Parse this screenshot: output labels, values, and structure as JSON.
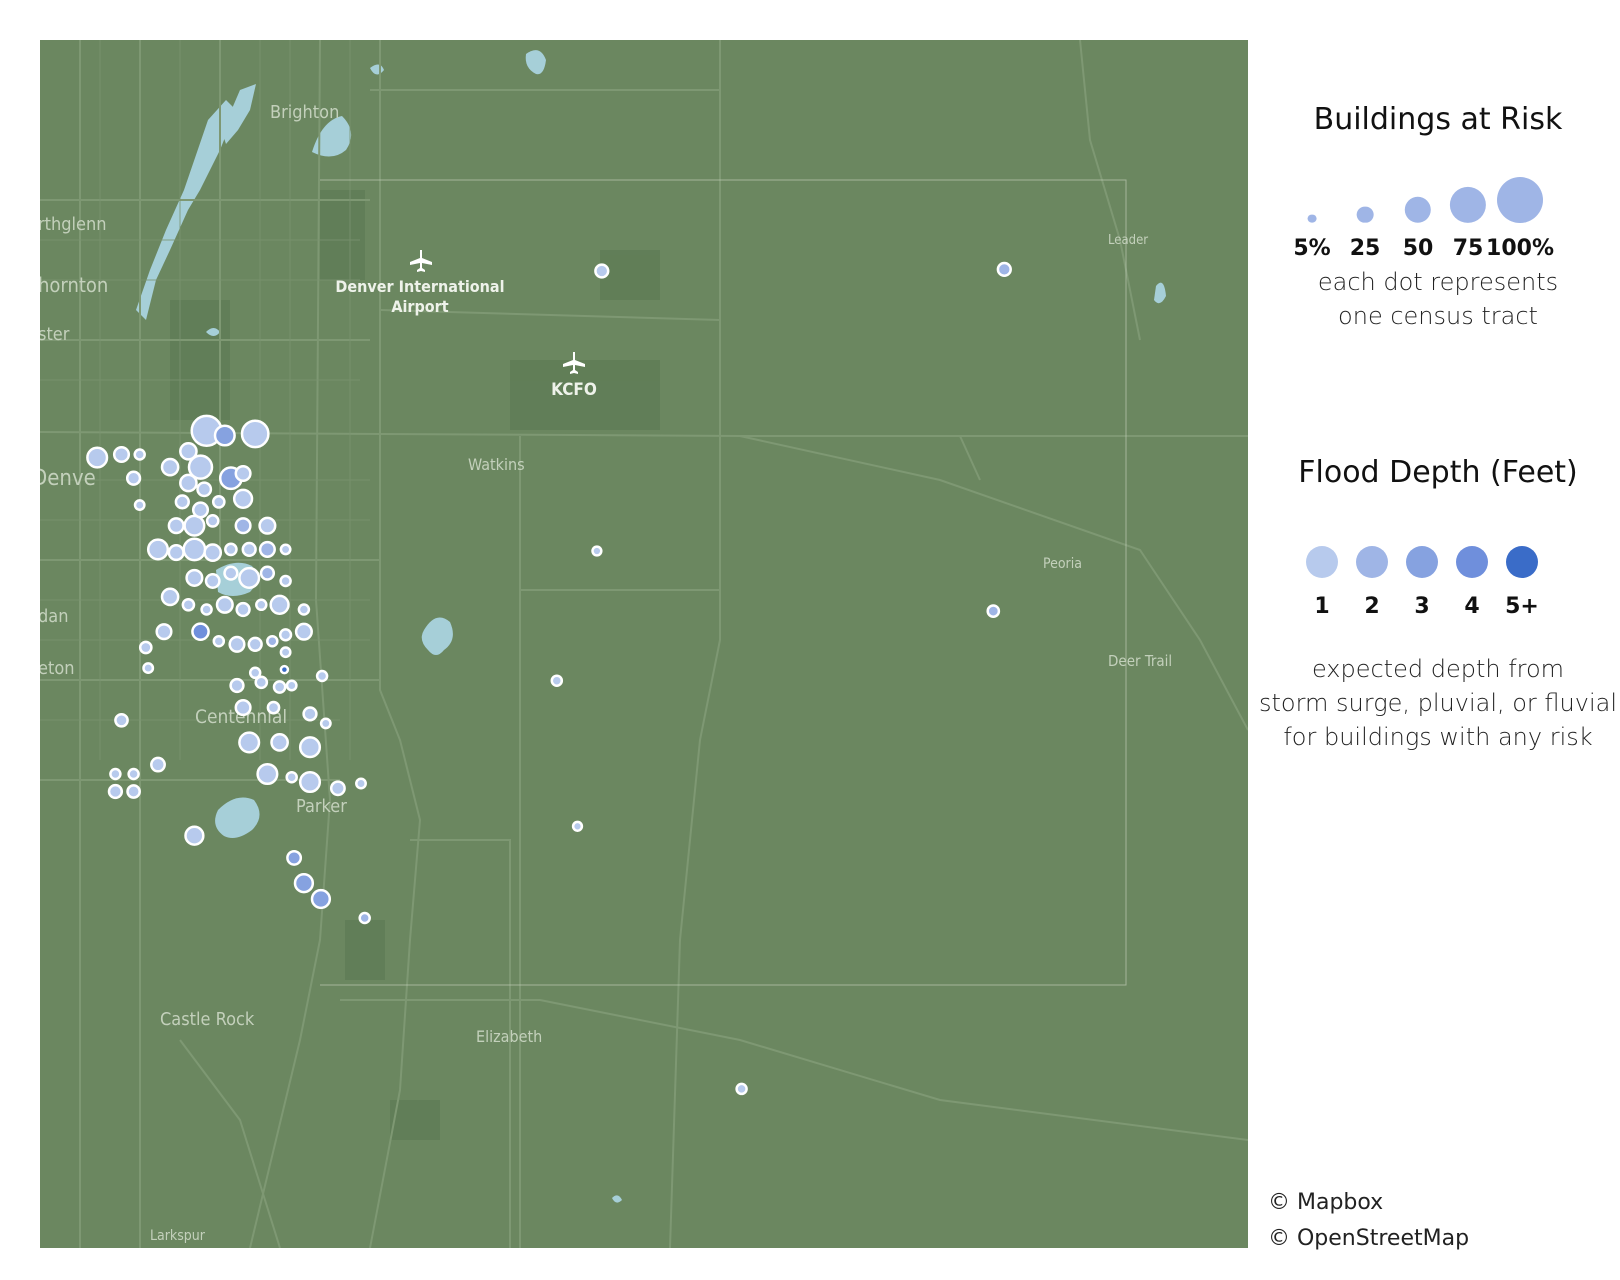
{
  "map": {
    "place_labels": [
      {
        "id": "brighton",
        "text": "Brighton"
      },
      {
        "id": "northglenn",
        "text": "rthglenn"
      },
      {
        "id": "thornton",
        "text": "hornton"
      },
      {
        "id": "westminster",
        "text": "ster"
      },
      {
        "id": "denver",
        "text": "Denve"
      },
      {
        "id": "sheridan",
        "text": "dan"
      },
      {
        "id": "littleton",
        "text": "eton"
      },
      {
        "id": "centennial",
        "text": "Centennial"
      },
      {
        "id": "parker",
        "text": "Parker"
      },
      {
        "id": "castle-rock",
        "text": "Castle Rock"
      },
      {
        "id": "elizabeth",
        "text": "Elizabeth"
      },
      {
        "id": "larkspur",
        "text": "Larkspur"
      },
      {
        "id": "watkins",
        "text": "Watkins"
      },
      {
        "id": "leader",
        "text": "Leader"
      },
      {
        "id": "peoria",
        "text": "Peoria"
      },
      {
        "id": "deer-trail",
        "text": "Deer Trail"
      },
      {
        "id": "dia-line1",
        "text": "Denver International"
      },
      {
        "id": "dia-line2",
        "text": "Airport"
      },
      {
        "id": "kcfo",
        "text": "KCFO"
      }
    ],
    "colors": {
      "land": "#6b8760",
      "road": "#7e9873",
      "water": "#a6cfd8",
      "park": "#5f7c56",
      "dot_outline": "#ffffff",
      "depth": [
        "#b7caed",
        "#9fb5e6",
        "#86a2e0",
        "#6f8fdc",
        "#3a6cc8"
      ]
    },
    "tracts": [
      {
        "lon": -104.95,
        "lat": 39.748,
        "risk": 40,
        "depth": 1
      },
      {
        "lon": -104.93,
        "lat": 39.75,
        "risk": 25,
        "depth": 1
      },
      {
        "lon": -104.915,
        "lat": 39.75,
        "risk": 12,
        "depth": 1
      },
      {
        "lon": -104.92,
        "lat": 39.735,
        "risk": 20,
        "depth": 1
      },
      {
        "lon": -104.915,
        "lat": 39.718,
        "risk": 10,
        "depth": 1
      },
      {
        "lon": -104.89,
        "lat": 39.742,
        "risk": 30,
        "depth": 1
      },
      {
        "lon": -104.875,
        "lat": 39.752,
        "risk": 30,
        "depth": 1
      },
      {
        "lon": -104.86,
        "lat": 39.765,
        "risk": 70,
        "depth": 1
      },
      {
        "lon": -104.865,
        "lat": 39.742,
        "risk": 50,
        "depth": 1
      },
      {
        "lon": -104.845,
        "lat": 39.762,
        "risk": 40,
        "depth": 3
      },
      {
        "lon": -104.82,
        "lat": 39.763,
        "risk": 60,
        "depth": 1
      },
      {
        "lon": -104.84,
        "lat": 39.735,
        "risk": 45,
        "depth": 3
      },
      {
        "lon": -104.83,
        "lat": 39.738,
        "risk": 25,
        "depth": 1
      },
      {
        "lon": -104.875,
        "lat": 39.732,
        "risk": 30,
        "depth": 1
      },
      {
        "lon": -104.862,
        "lat": 39.728,
        "risk": 22,
        "depth": 1
      },
      {
        "lon": -104.88,
        "lat": 39.72,
        "risk": 20,
        "depth": 1
      },
      {
        "lon": -104.865,
        "lat": 39.715,
        "risk": 25,
        "depth": 1
      },
      {
        "lon": -104.85,
        "lat": 39.72,
        "risk": 15,
        "depth": 1
      },
      {
        "lon": -104.885,
        "lat": 39.705,
        "risk": 25,
        "depth": 1
      },
      {
        "lon": -104.87,
        "lat": 39.705,
        "risk": 40,
        "depth": 1
      },
      {
        "lon": -104.855,
        "lat": 39.708,
        "risk": 15,
        "depth": 1
      },
      {
        "lon": -104.83,
        "lat": 39.722,
        "risk": 35,
        "depth": 1
      },
      {
        "lon": -104.83,
        "lat": 39.705,
        "risk": 25,
        "depth": 2
      },
      {
        "lon": -104.81,
        "lat": 39.705,
        "risk": 28,
        "depth": 1
      },
      {
        "lon": -104.9,
        "lat": 39.69,
        "risk": 40,
        "depth": 1
      },
      {
        "lon": -104.885,
        "lat": 39.688,
        "risk": 25,
        "depth": 1
      },
      {
        "lon": -104.87,
        "lat": 39.69,
        "risk": 45,
        "depth": 1
      },
      {
        "lon": -104.855,
        "lat": 39.688,
        "risk": 30,
        "depth": 1
      },
      {
        "lon": -104.84,
        "lat": 39.69,
        "risk": 15,
        "depth": 1
      },
      {
        "lon": -104.825,
        "lat": 39.69,
        "risk": 20,
        "depth": 1
      },
      {
        "lon": -104.81,
        "lat": 39.69,
        "risk": 25,
        "depth": 2
      },
      {
        "lon": -104.795,
        "lat": 39.69,
        "risk": 10,
        "depth": 1
      },
      {
        "lon": -104.87,
        "lat": 39.672,
        "risk": 28,
        "depth": 1
      },
      {
        "lon": -104.855,
        "lat": 39.67,
        "risk": 22,
        "depth": 1
      },
      {
        "lon": -104.84,
        "lat": 39.675,
        "risk": 20,
        "depth": 1
      },
      {
        "lon": -104.825,
        "lat": 39.672,
        "risk": 40,
        "depth": 1
      },
      {
        "lon": -104.81,
        "lat": 39.675,
        "risk": 20,
        "depth": 2
      },
      {
        "lon": -104.795,
        "lat": 39.67,
        "risk": 12,
        "depth": 1
      },
      {
        "lon": -104.89,
        "lat": 39.66,
        "risk": 30,
        "depth": 1
      },
      {
        "lon": -104.875,
        "lat": 39.655,
        "risk": 15,
        "depth": 1
      },
      {
        "lon": -104.86,
        "lat": 39.652,
        "risk": 12,
        "depth": 1
      },
      {
        "lon": -104.845,
        "lat": 39.655,
        "risk": 28,
        "depth": 1
      },
      {
        "lon": -104.83,
        "lat": 39.652,
        "risk": 20,
        "depth": 1
      },
      {
        "lon": -104.815,
        "lat": 39.655,
        "risk": 12,
        "depth": 1
      },
      {
        "lon": -104.8,
        "lat": 39.655,
        "risk": 35,
        "depth": 1
      },
      {
        "lon": -104.78,
        "lat": 39.652,
        "risk": 12,
        "depth": 1
      },
      {
        "lon": -104.895,
        "lat": 39.638,
        "risk": 25,
        "depth": 1
      },
      {
        "lon": -104.865,
        "lat": 39.638,
        "risk": 30,
        "depth": 4
      },
      {
        "lon": -104.85,
        "lat": 39.632,
        "risk": 12,
        "depth": 1
      },
      {
        "lon": -104.835,
        "lat": 39.63,
        "risk": 25,
        "depth": 1
      },
      {
        "lon": -104.82,
        "lat": 39.63,
        "risk": 20,
        "depth": 1
      },
      {
        "lon": -104.806,
        "lat": 39.632,
        "risk": 12,
        "depth": 2
      },
      {
        "lon": -104.795,
        "lat": 39.636,
        "risk": 14,
        "depth": 1
      },
      {
        "lon": -104.78,
        "lat": 39.638,
        "risk": 28,
        "depth": 1
      },
      {
        "lon": -104.91,
        "lat": 39.628,
        "risk": 15,
        "depth": 1
      },
      {
        "lon": -104.795,
        "lat": 39.625,
        "risk": 10,
        "depth": 1
      },
      {
        "lon": -104.908,
        "lat": 39.615,
        "risk": 10,
        "depth": 1
      },
      {
        "lon": -104.82,
        "lat": 39.612,
        "risk": 12,
        "depth": 1
      },
      {
        "lon": -104.796,
        "lat": 39.614,
        "risk": 3,
        "depth": 5
      },
      {
        "lon": -104.835,
        "lat": 39.604,
        "risk": 20,
        "depth": 1
      },
      {
        "lon": -104.815,
        "lat": 39.606,
        "risk": 15,
        "depth": 1
      },
      {
        "lon": -104.8,
        "lat": 39.603,
        "risk": 15,
        "depth": 1
      },
      {
        "lon": -104.79,
        "lat": 39.604,
        "risk": 10,
        "depth": 1
      },
      {
        "lon": -104.765,
        "lat": 39.61,
        "risk": 12,
        "depth": 1
      },
      {
        "lon": -104.83,
        "lat": 39.59,
        "risk": 25,
        "depth": 1
      },
      {
        "lon": -104.805,
        "lat": 39.59,
        "risk": 15,
        "depth": 1
      },
      {
        "lon": -104.775,
        "lat": 39.586,
        "risk": 20,
        "depth": 1
      },
      {
        "lon": -104.762,
        "lat": 39.58,
        "risk": 10,
        "depth": 1
      },
      {
        "lon": -104.93,
        "lat": 39.582,
        "risk": 18,
        "depth": 1
      },
      {
        "lon": -104.825,
        "lat": 39.568,
        "risk": 40,
        "depth": 1
      },
      {
        "lon": -104.8,
        "lat": 39.568,
        "risk": 30,
        "depth": 1
      },
      {
        "lon": -104.775,
        "lat": 39.565,
        "risk": 40,
        "depth": 1
      },
      {
        "lon": -104.9,
        "lat": 39.554,
        "risk": 22,
        "depth": 1
      },
      {
        "lon": -104.935,
        "lat": 39.548,
        "risk": 12,
        "depth": 1
      },
      {
        "lon": -104.92,
        "lat": 39.548,
        "risk": 12,
        "depth": 1
      },
      {
        "lon": -104.81,
        "lat": 39.548,
        "risk": 40,
        "depth": 1
      },
      {
        "lon": -104.79,
        "lat": 39.546,
        "risk": 12,
        "depth": 1
      },
      {
        "lon": -104.775,
        "lat": 39.543,
        "risk": 40,
        "depth": 1
      },
      {
        "lon": -104.752,
        "lat": 39.539,
        "risk": 22,
        "depth": 1
      },
      {
        "lon": -104.733,
        "lat": 39.542,
        "risk": 10,
        "depth": 1
      },
      {
        "lon": -104.935,
        "lat": 39.537,
        "risk": 20,
        "depth": 1
      },
      {
        "lon": -104.92,
        "lat": 39.537,
        "risk": 18,
        "depth": 1
      },
      {
        "lon": -104.87,
        "lat": 39.509,
        "risk": 35,
        "depth": 1
      },
      {
        "lon": -104.788,
        "lat": 39.495,
        "risk": 22,
        "depth": 3
      },
      {
        "lon": -104.78,
        "lat": 39.479,
        "risk": 35,
        "depth": 3
      },
      {
        "lon": -104.766,
        "lat": 39.469,
        "risk": 35,
        "depth": 3
      },
      {
        "lon": -104.73,
        "lat": 39.457,
        "risk": 12,
        "depth": 2
      },
      {
        "lon": -104.535,
        "lat": 39.866,
        "risk": 20,
        "depth": 1
      },
      {
        "lon": -104.539,
        "lat": 39.689,
        "risk": 8,
        "depth": 1
      },
      {
        "lon": -104.572,
        "lat": 39.607,
        "risk": 12,
        "depth": 1
      },
      {
        "lon": -104.555,
        "lat": 39.515,
        "risk": 8,
        "depth": 1
      },
      {
        "lon": -104.42,
        "lat": 39.349,
        "risk": 12,
        "depth": 1
      },
      {
        "lon": -104.204,
        "lat": 39.867,
        "risk": 20,
        "depth": 2
      },
      {
        "lon": -104.213,
        "lat": 39.651,
        "risk": 15,
        "depth": 2
      }
    ]
  },
  "legend_size": {
    "title": "Buildings at Risk",
    "ticks": [
      {
        "label": "5%",
        "value": 5
      },
      {
        "label": "25",
        "value": 25
      },
      {
        "label": "50",
        "value": 50
      },
      {
        "label": "75",
        "value": 75
      },
      {
        "label": "100%",
        "value": 100
      }
    ],
    "note": "each dot represents\none census tract"
  },
  "legend_depth": {
    "title": "Flood Depth (Feet)",
    "ticks": [
      "1",
      "2",
      "3",
      "4",
      "5+"
    ],
    "note": "expected depth from\nstorm surge, pluvial, or fluvial\nfor buildings with any risk"
  },
  "attribution": {
    "mapbox": "© Mapbox",
    "osm": "© OpenStreetMap"
  }
}
